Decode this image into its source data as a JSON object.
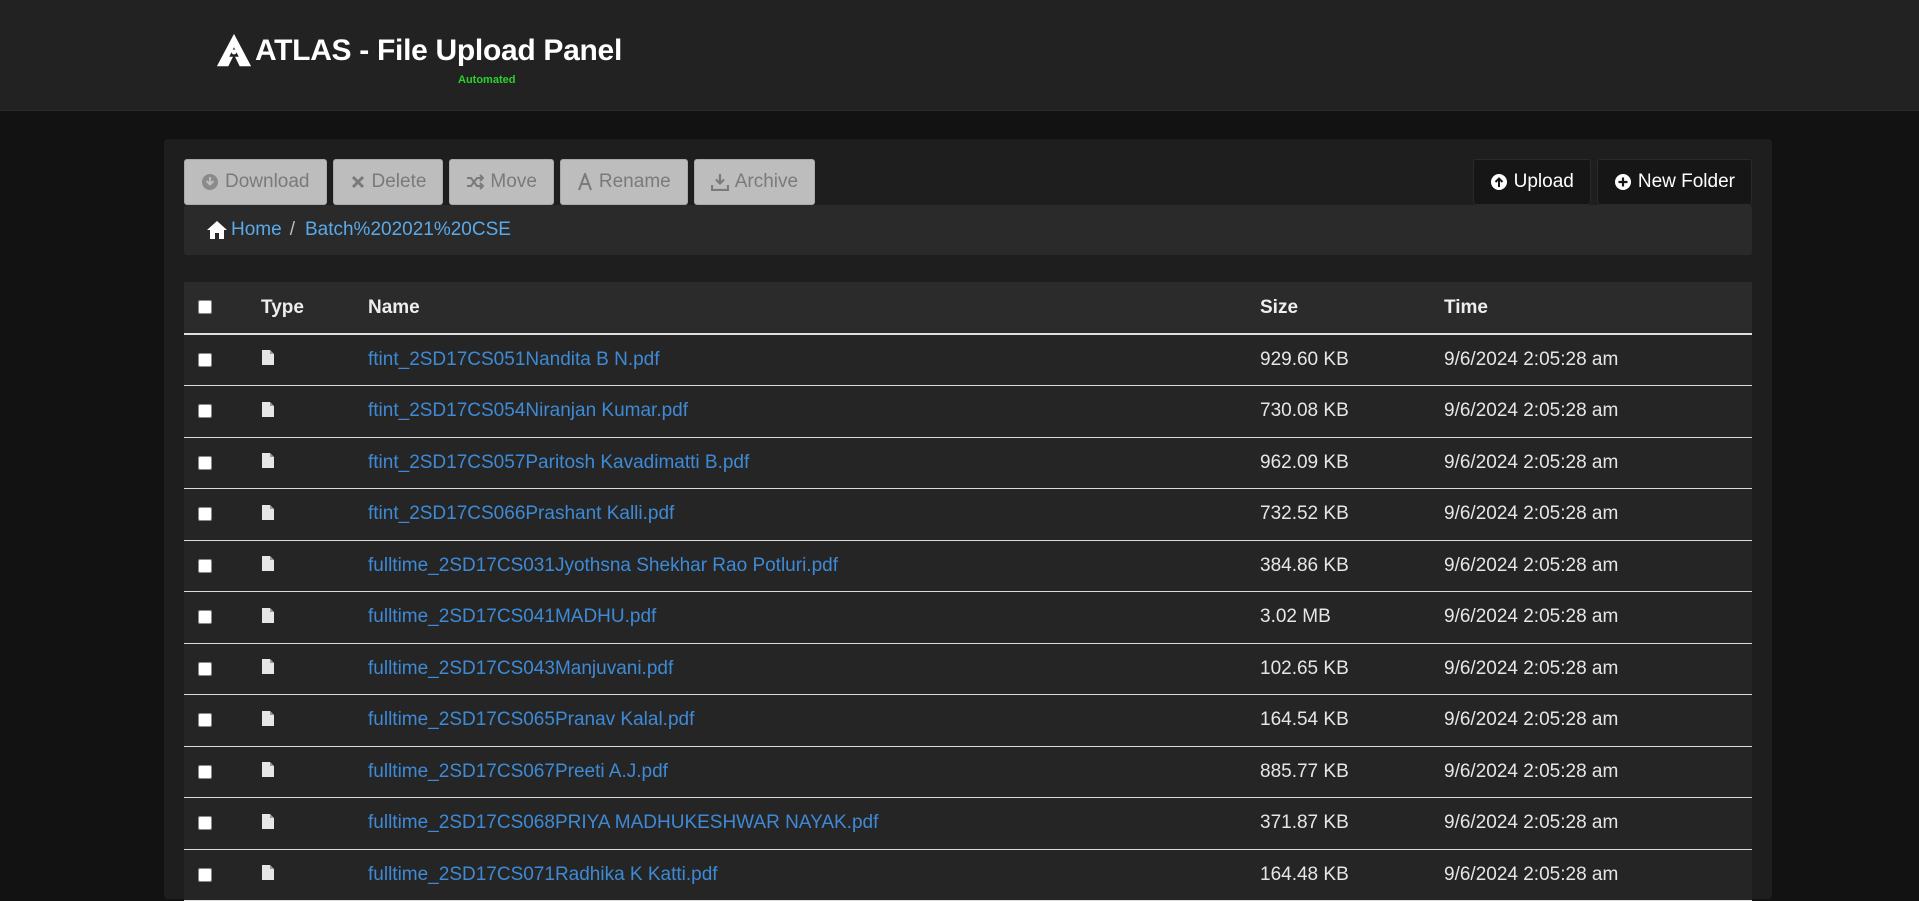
{
  "header": {
    "title": "ATLAS - File Upload Panel",
    "subtitle": "Automated"
  },
  "toolbar": {
    "download_label": "Download",
    "delete_label": "Delete",
    "move_label": "Move",
    "rename_label": "Rename",
    "archive_label": "Archive",
    "upload_label": "Upload",
    "new_folder_label": "New Folder"
  },
  "breadcrumb": {
    "home_label": "Home",
    "separator": "/",
    "current": "Batch%202021%20CSE"
  },
  "table": {
    "columns": {
      "type": "Type",
      "name": "Name",
      "size": "Size",
      "time": "Time"
    },
    "rows": [
      {
        "name": "ftint_2SD17CS051Nandita B N.pdf",
        "size": "929.60 KB",
        "time": "9/6/2024 2:05:28 am"
      },
      {
        "name": "ftint_2SD17CS054Niranjan Kumar.pdf",
        "size": "730.08 KB",
        "time": "9/6/2024 2:05:28 am"
      },
      {
        "name": "ftint_2SD17CS057Paritosh Kavadimatti B.pdf",
        "size": "962.09 KB",
        "time": "9/6/2024 2:05:28 am"
      },
      {
        "name": "ftint_2SD17CS066Prashant Kalli.pdf",
        "size": "732.52 KB",
        "time": "9/6/2024 2:05:28 am"
      },
      {
        "name": "fulltime_2SD17CS031Jyothsna Shekhar Rao Potluri.pdf",
        "size": "384.86 KB",
        "time": "9/6/2024 2:05:28 am"
      },
      {
        "name": "fulltime_2SD17CS041MADHU.pdf",
        "size": "3.02 MB",
        "time": "9/6/2024 2:05:28 am"
      },
      {
        "name": "fulltime_2SD17CS043Manjuvani.pdf",
        "size": "102.65 KB",
        "time": "9/6/2024 2:05:28 am"
      },
      {
        "name": "fulltime_2SD17CS065Pranav Kalal.pdf",
        "size": "164.54 KB",
        "time": "9/6/2024 2:05:28 am"
      },
      {
        "name": "fulltime_2SD17CS067Preeti A.J.pdf",
        "size": "885.77 KB",
        "time": "9/6/2024 2:05:28 am"
      },
      {
        "name": "fulltime_2SD17CS068PRIYA MADHUKESHWAR NAYAK.pdf",
        "size": "371.87 KB",
        "time": "9/6/2024 2:05:28 am"
      },
      {
        "name": "fulltime_2SD17CS071Radhika K Katti.pdf",
        "size": "164.48 KB",
        "time": "9/6/2024 2:05:28 am"
      }
    ]
  },
  "colors": {
    "accent_green": "#2dd12d",
    "link_blue": "#3e8ad6",
    "breadcrumb_blue": "#5aa9e8"
  },
  "icons": {
    "logo": "atlas-logo-icon",
    "download": "download-icon",
    "delete": "close-icon",
    "move": "shuffle-icon",
    "rename": "font-icon",
    "archive": "archive-download-icon",
    "upload": "upload-circle-icon",
    "new_folder": "plus-circle-icon",
    "home": "home-icon",
    "file": "file-icon"
  }
}
